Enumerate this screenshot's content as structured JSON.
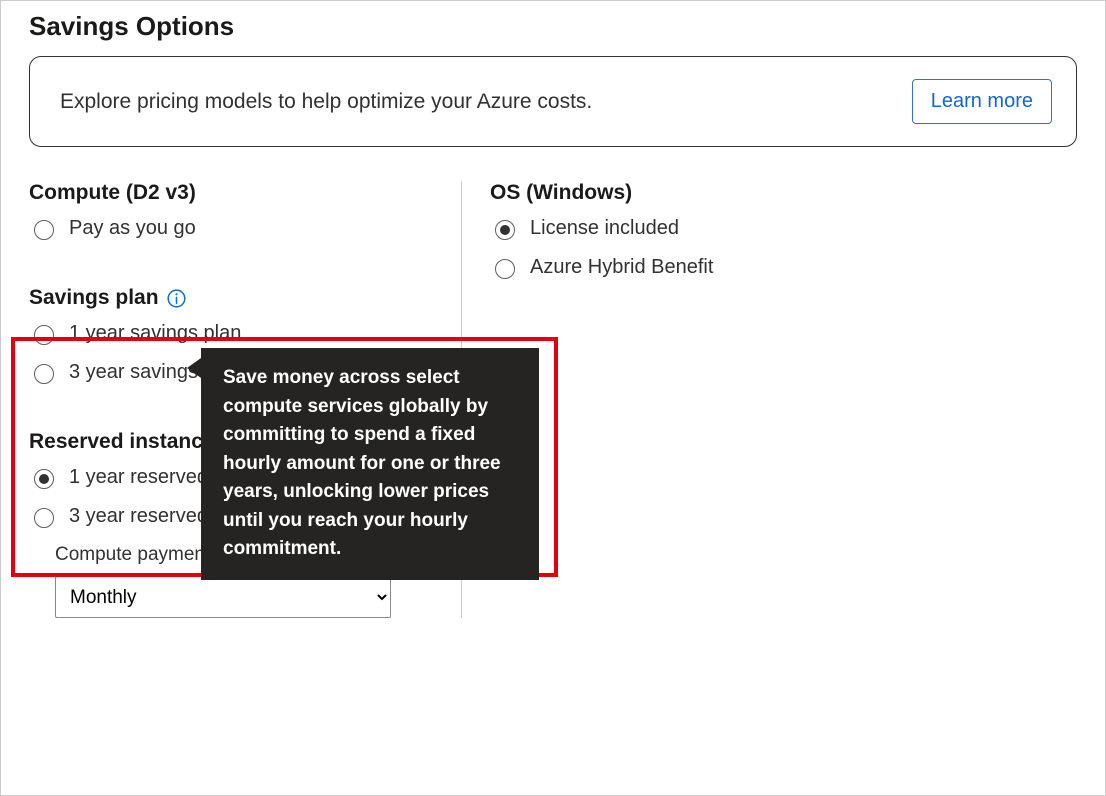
{
  "title": "Savings Options",
  "banner": {
    "text": "Explore pricing models to help optimize your Azure costs.",
    "button": "Learn more"
  },
  "compute": {
    "title": "Compute (D2 v3)",
    "options": [
      {
        "label": "Pay as you go",
        "checked": false
      }
    ]
  },
  "savings_plan": {
    "title": "Savings plan",
    "tooltip": "Save money across select compute services globally by committing to spend a fixed hourly amount for one or three years, unlocking lower prices until you reach your hourly commitment.",
    "options": [
      {
        "label": "1 year savings plan",
        "checked": false
      },
      {
        "label": "3 year savings plan",
        "checked": false
      }
    ]
  },
  "reserved": {
    "title": "Reserved instances",
    "options": [
      {
        "label": "1 year reserved (~40% discount)",
        "checked": true
      },
      {
        "label": "3 year reserved (~62% discount)",
        "checked": false
      }
    ],
    "payment_label": "Compute payment options:",
    "payment_value": "Monthly"
  },
  "os": {
    "title": "OS (Windows)",
    "options": [
      {
        "label": "License included",
        "checked": true
      },
      {
        "label": "Azure Hybrid Benefit",
        "checked": false
      }
    ]
  }
}
